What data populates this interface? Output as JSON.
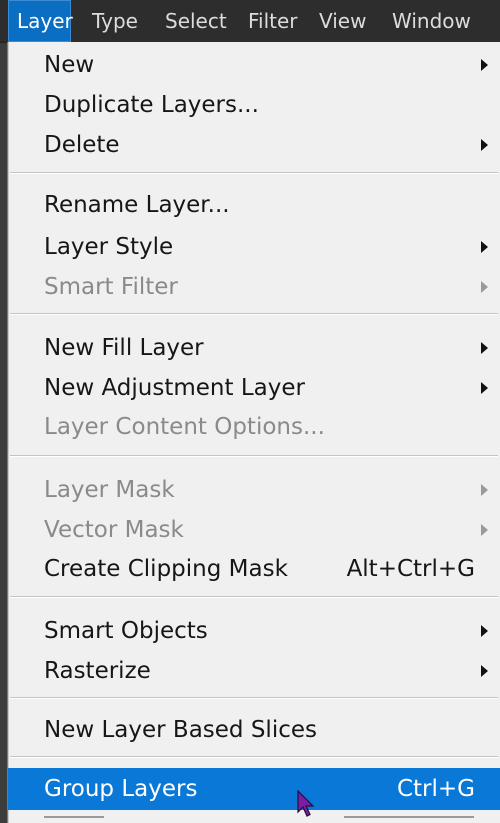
{
  "menubar": {
    "items": [
      {
        "label": "Layer",
        "active": true
      },
      {
        "label": "Type"
      },
      {
        "label": "Select"
      },
      {
        "label": "Filter"
      },
      {
        "label": "View"
      },
      {
        "label": "Window"
      }
    ]
  },
  "layer_menu": {
    "items": [
      {
        "label": "New",
        "submenu": true
      },
      {
        "label": "Duplicate Layers..."
      },
      {
        "label": "Delete",
        "submenu": true
      },
      {
        "label": "Rename Layer..."
      },
      {
        "label": "Layer Style",
        "submenu": true
      },
      {
        "label": "Smart Filter",
        "submenu": true,
        "disabled": true
      },
      {
        "label": "New Fill Layer",
        "submenu": true
      },
      {
        "label": "New Adjustment Layer",
        "submenu": true
      },
      {
        "label": "Layer Content Options...",
        "disabled": true
      },
      {
        "label": "Layer Mask",
        "submenu": true,
        "disabled": true
      },
      {
        "label": "Vector Mask",
        "submenu": true,
        "disabled": true
      },
      {
        "label": "Create Clipping Mask",
        "shortcut": "Alt+Ctrl+G"
      },
      {
        "label": "Smart Objects",
        "submenu": true
      },
      {
        "label": "Rasterize",
        "submenu": true
      },
      {
        "label": "New Layer Based Slices"
      },
      {
        "label": "Group Layers",
        "shortcut": "Ctrl+G",
        "highlighted": true
      }
    ]
  },
  "colors": {
    "menubar_bg": "#2d2d2d",
    "menu_bg": "#f0f0f0",
    "highlight": "#0a78d7",
    "disabled_text": "#8a8a8a",
    "cursor": "#7b1fa2"
  }
}
